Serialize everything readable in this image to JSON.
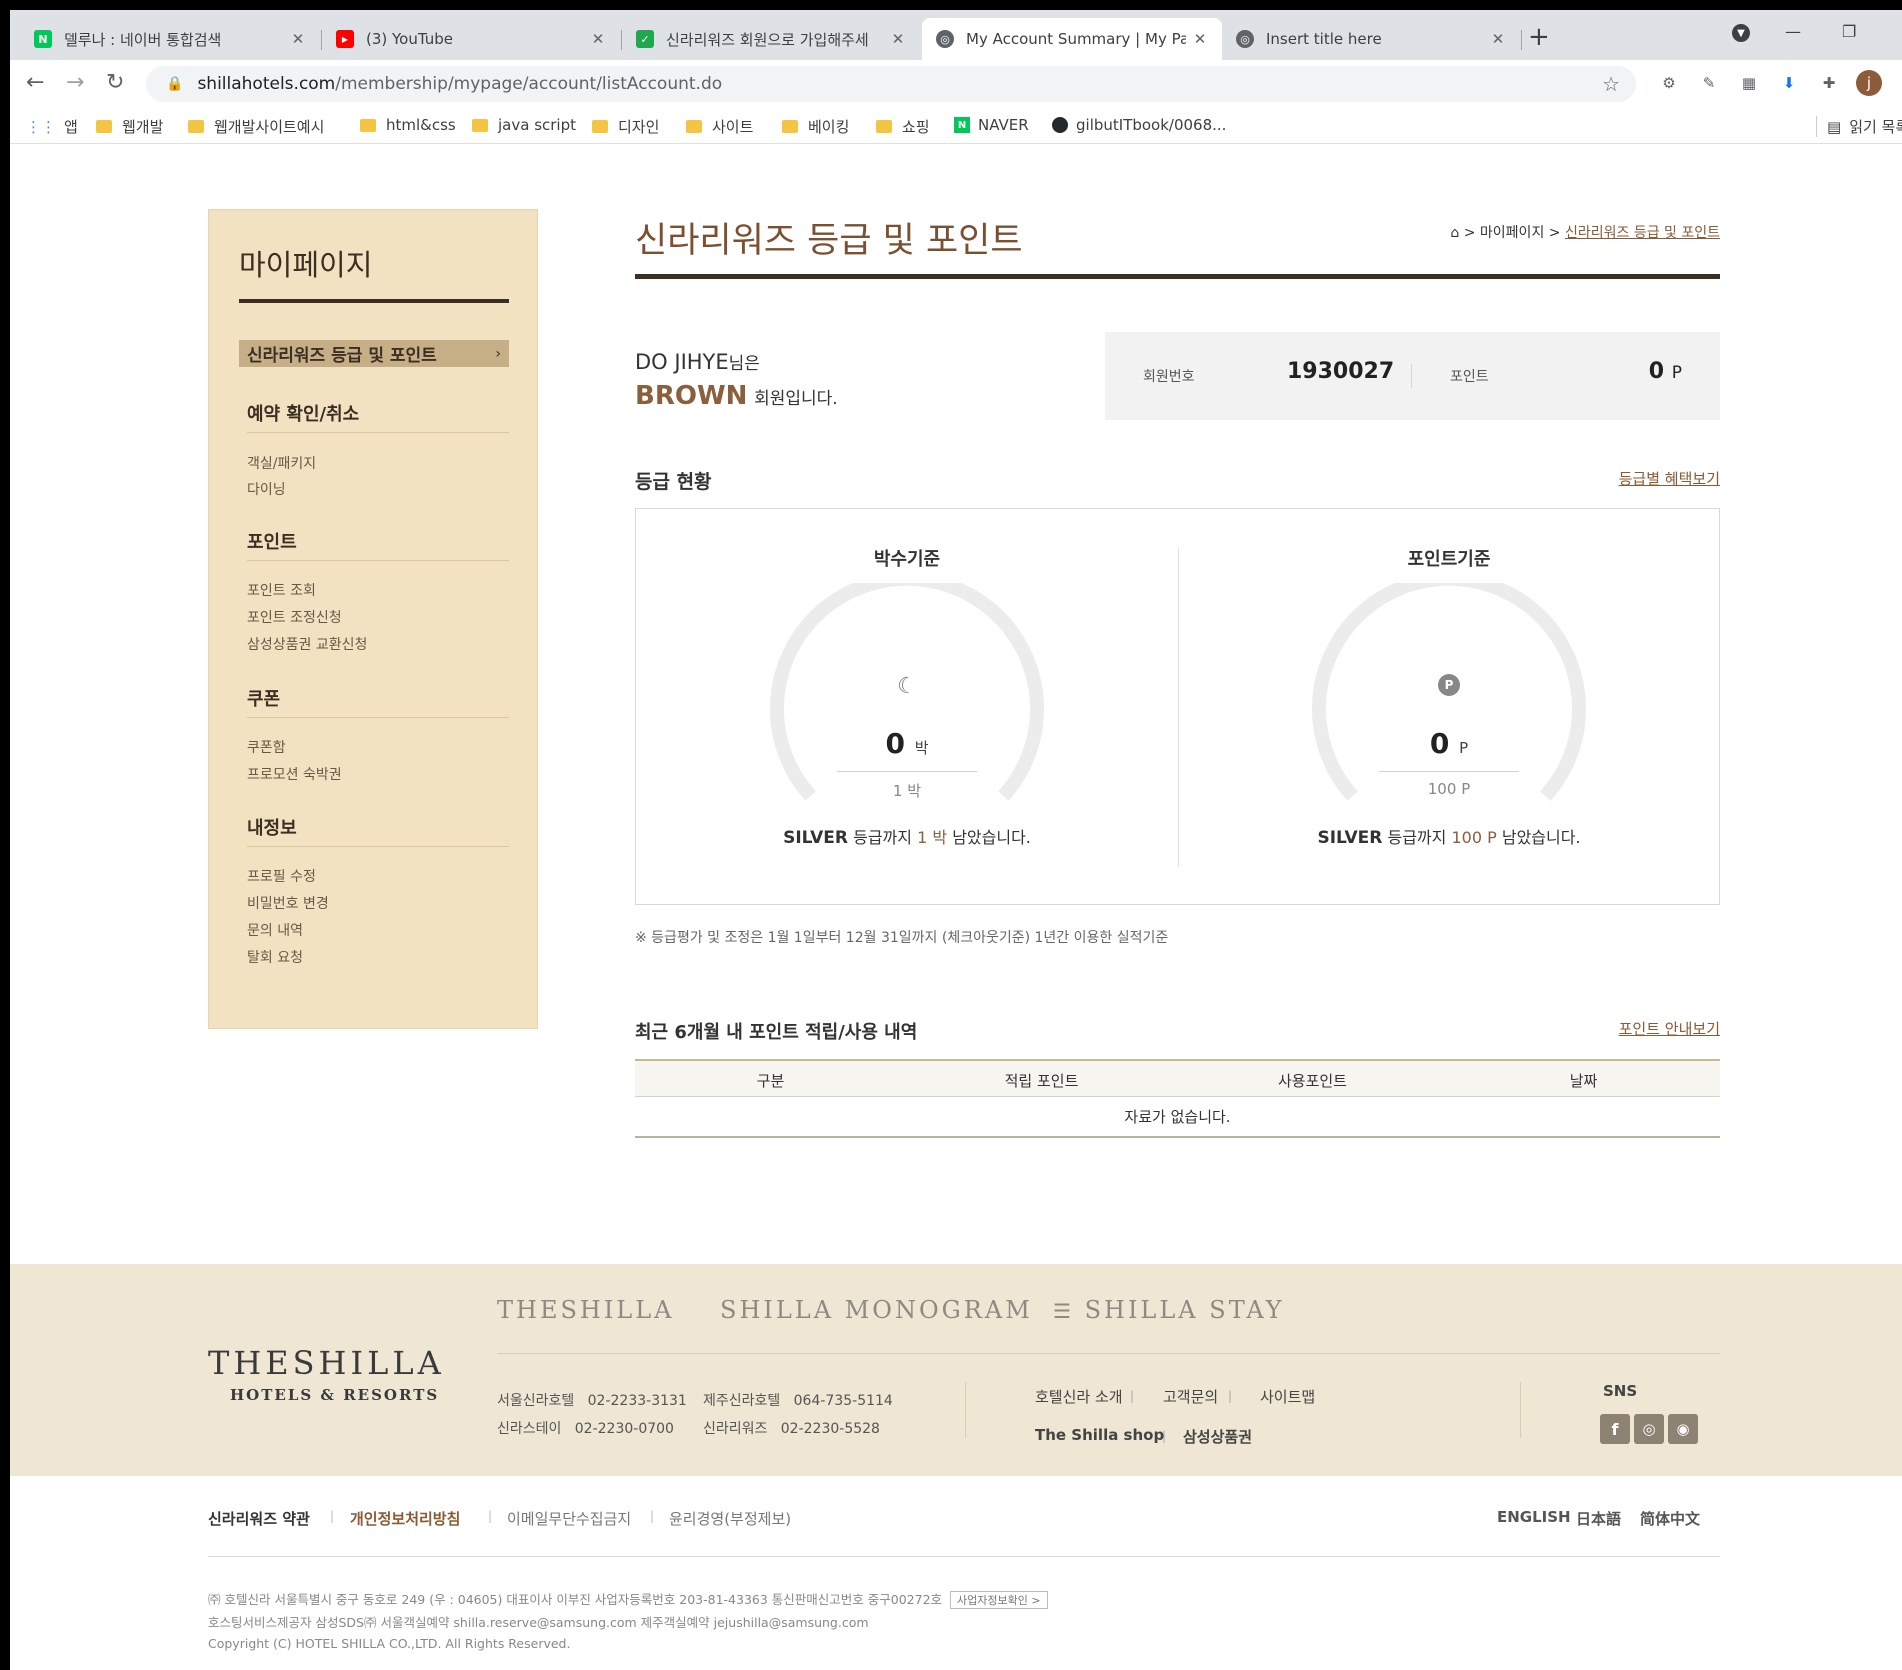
{
  "browser": {
    "tabs": [
      {
        "title": "델루나 : 네이버 통합검색",
        "icon": "naver-icon",
        "active": false
      },
      {
        "title": "(3) YouTube",
        "icon": "youtube-icon",
        "active": false
      },
      {
        "title": "신라리워즈 회원으로 가입해주세",
        "icon": "shilla-icon",
        "active": false
      },
      {
        "title": "My Account Summary | My Pag",
        "icon": "globe-icon",
        "active": true
      },
      {
        "title": "Insert title here",
        "icon": "globe-icon",
        "active": false
      }
    ],
    "url_domain": "shillahotels.com",
    "url_path": "/membership/mypage/account/listAccount.do",
    "profile_initial": "j",
    "bookmarks": [
      "앱",
      "웹개발",
      "웹개발사이트예시",
      "html&css",
      "java script",
      "디자인",
      "사이트",
      "베이킹",
      "쇼핑",
      "NAVER",
      "gilbutITbook/0068..."
    ],
    "reading_list": "읽기 목록"
  },
  "sidebar": {
    "title": "마이페이지",
    "active_item": "신라리워즈 등급 및 포인트",
    "sections": [
      {
        "heading": "예약 확인/취소",
        "items": [
          "객실/패키지",
          "다이닝"
        ]
      },
      {
        "heading": "포인트",
        "items": [
          "포인트 조회",
          "포인트 조정신청",
          "삼성상품권 교환신청"
        ]
      },
      {
        "heading": "쿠폰",
        "items": [
          "쿠폰함",
          "프로모션 숙박권"
        ]
      },
      {
        "heading": "내정보",
        "items": [
          "프로필 수정",
          "비밀번호 변경",
          "문의 내역",
          "탈회 요청"
        ]
      }
    ]
  },
  "main": {
    "title": "신라리워즈 등급 및 포인트",
    "breadcrumb": {
      "sep": ">",
      "parent": "마이페이지",
      "current": "신라리워즈 등급 및 포인트"
    },
    "member": {
      "name": "DO JIHYE",
      "name_suffix": "님은",
      "grade": "BROWN",
      "grade_suffix": "회원입니다."
    },
    "info": {
      "member_no_label": "회원번호",
      "member_no": "1930027",
      "points_label": "포인트",
      "points": "0",
      "points_unit": "P"
    },
    "grade_section": {
      "title": "등급 현황",
      "link": "등급별 혜택보기"
    },
    "gauges": [
      {
        "title": "박수기준",
        "icon": "moon-icon",
        "value": "0",
        "unit": "박",
        "target": "1",
        "target_unit": "박",
        "next_grade": "SILVER",
        "msg_mid": "등급까지",
        "remain": "1",
        "remain_unit": "박",
        "msg_end": "남았습니다.",
        "progress": 0
      },
      {
        "title": "포인트기준",
        "icon": "point-icon",
        "value": "0",
        "unit": "P",
        "target": "100",
        "target_unit": "P",
        "next_grade": "SILVER",
        "msg_mid": "등급까지",
        "remain": "100",
        "remain_unit": "P",
        "msg_end": "남았습니다.",
        "progress": 0
      }
    ],
    "note": "※ 등급평가 및 조정은 1월 1일부터 12월 31일까지 (체크아웃기준) 1년간 이용한 실적기준",
    "history": {
      "title": "최근 6개월 내 포인트 적립/사용 내역",
      "link": "포인트 안내보기",
      "columns": [
        "구분",
        "적립 포인트",
        "사용포인트",
        "날짜"
      ],
      "empty": "자료가 없습니다."
    }
  },
  "footer": {
    "logo_main": "THESHILLA",
    "logo_sub": "HOTELS & RESORTS",
    "brands": [
      "THESHILLA",
      "SHILLA MONOGRAM",
      "SHILLA STAY"
    ],
    "phones": [
      {
        "name": "서울신라호텔",
        "tel": "02-2233-3131"
      },
      {
        "name": "제주신라호텔",
        "tel": "064-735-5114"
      },
      {
        "name": "신라스테이",
        "tel": "02-2230-0700"
      },
      {
        "name": "신라리워즈",
        "tel": "02-2230-5528"
      }
    ],
    "links_row1": [
      "호텔신라 소개",
      "고객문의",
      "사이트맵"
    ],
    "links_row2": [
      "The Shilla shop",
      "삼성상품권"
    ],
    "sns_label": "SNS",
    "sns": [
      "facebook-icon",
      "instagram-icon",
      "weibo-icon"
    ],
    "policy_links": [
      "신라리워즈 약관",
      "개인정보처리방침",
      "이메일무단수집금지",
      "윤리경영(부정제보)"
    ],
    "languages": [
      "ENGLISH",
      "日本語",
      "简体中文"
    ],
    "company_line1": "㈜ 호텔신라 서울특별시 중구 동호로 249 (우 : 04605)   대표이사 이부진   사업자등록번호 203-81-43363   통신판매신고번호 중구00272호",
    "biz_button": "사업자정보확인 >",
    "company_line2": "호스팅서비스제공자 삼성SDS㈜   서울객실예약 shilla.reserve@samsung.com  제주객실예약 jejushilla@samsung.com",
    "copyright": "Copyright (C) HOTEL SHILLA CO.,LTD. All Rights Reserved."
  }
}
